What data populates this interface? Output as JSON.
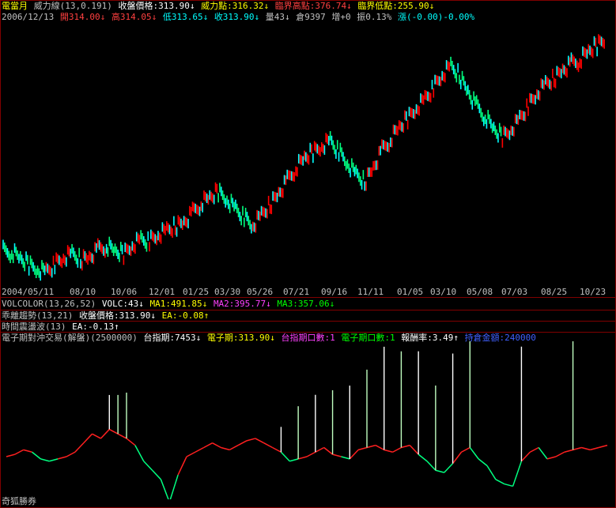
{
  "header": {
    "line1": [
      {
        "t": "電當月",
        "c": "c-yel"
      },
      {
        "t": "威力線(13,0.191)",
        "c": "c-gray"
      },
      {
        "t": "收盤價格:313.90↓",
        "c": "c-white"
      },
      {
        "t": "威力點:316.32↓",
        "c": "c-yel"
      },
      {
        "t": "臨界高點:376.74↓",
        "c": "c-red"
      },
      {
        "t": "臨界低點:255.90↓",
        "c": "c-yel"
      }
    ],
    "line2": [
      {
        "t": "2006/12/13",
        "c": "c-gray"
      },
      {
        "t": "開314.00↓",
        "c": "c-red"
      },
      {
        "t": "高314.05↓",
        "c": "c-red"
      },
      {
        "t": "低313.65↓",
        "c": "c-cyan"
      },
      {
        "t": "收313.90↓",
        "c": "c-cyan"
      },
      {
        "t": "量43↓",
        "c": "c-gray"
      },
      {
        "t": "倉9397",
        "c": "c-gray"
      },
      {
        "t": "增+0",
        "c": "c-gray"
      },
      {
        "t": "振0.13%",
        "c": "c-gray"
      },
      {
        "t": "漲(-0.00)-0.00%",
        "c": "c-cyan"
      }
    ]
  },
  "indicators": {
    "volcolor": [
      {
        "t": "VOLCOLOR(13,26,52)",
        "c": "c-gray"
      },
      {
        "t": "VOLC:43↓",
        "c": "c-white"
      },
      {
        "t": "MA1:491.85↓",
        "c": "c-yel"
      },
      {
        "t": "MA2:395.77↓",
        "c": "c-mag"
      },
      {
        "t": "MA3:357.06↓",
        "c": "c-grn"
      }
    ],
    "deviation": [
      {
        "t": "乖離趨勢(13,21)",
        "c": "c-gray"
      },
      {
        "t": "收盤價格:313.90↓",
        "c": "c-white"
      },
      {
        "t": "EA:-0.08↑",
        "c": "c-yel"
      }
    ],
    "oscillation": [
      {
        "t": "時間震盪波(13)",
        "c": "c-gray"
      },
      {
        "t": "EA:-0.13↑",
        "c": "c-white"
      }
    ],
    "hedge": [
      {
        "t": "電子期對沖交易(解盤)(2500000)",
        "c": "c-gray"
      },
      {
        "t": "台指期:7453↓",
        "c": "c-white"
      },
      {
        "t": "電子期:313.90↓",
        "c": "c-yel"
      },
      {
        "t": "台指期口數:1",
        "c": "c-mag"
      },
      {
        "t": "電子期口數:1",
        "c": "c-grn"
      },
      {
        "t": "報酬率:3.49↑",
        "c": "c-white"
      },
      {
        "t": "持倉金額:240000",
        "c": "c-blue"
      }
    ]
  },
  "colors": {
    "up": "#ff2020",
    "down": "#00ff80",
    "bullish_bar": "#ff0000",
    "bearish_bar": "#00ffff",
    "border": "#800000",
    "spike": "#ffffff"
  },
  "chart_data": [
    {
      "type": "line",
      "x_tick_labels": [
        "2004/05/11",
        "08/10",
        "10/06",
        "12/01",
        "01/25",
        "03/30",
        "05/26",
        "07/21",
        "09/16",
        "11/11",
        "01/05",
        "03/10",
        "05/08",
        "07/03",
        "08/25",
        "10/23"
      ],
      "series": [
        {
          "values": [
            310,
            308,
            300,
            292,
            286,
            284,
            292,
            300,
            306,
            298,
            302,
            312,
            316,
            310,
            306,
            318,
            326,
            322,
            330,
            336,
            342,
            348,
            360,
            372,
            380,
            388,
            378,
            366,
            354,
            342,
            356,
            370,
            386,
            402,
            418,
            432,
            440,
            448,
            456,
            440,
            424,
            410,
            400,
            420,
            442,
            456,
            472,
            484,
            498,
            510,
            524,
            540,
            552,
            540,
            520,
            500,
            486,
            470,
            460,
            470,
            484,
            500,
            516,
            528,
            536,
            548,
            556,
            560,
            572,
            580,
            590
          ]
        }
      ]
    },
    {
      "type": "line",
      "series": [
        {
          "values": [
            0,
            1,
            3,
            2,
            -1,
            -2,
            -1,
            0,
            2,
            6,
            10,
            8,
            12,
            10,
            8,
            5,
            -2,
            -6,
            -10,
            -20,
            -8,
            0,
            2,
            4,
            6,
            4,
            3,
            5,
            7,
            8,
            6,
            4,
            2,
            -2,
            -1,
            0,
            2,
            4,
            1,
            0,
            -1,
            3,
            4,
            5,
            3,
            2,
            4,
            5,
            1,
            -2,
            -6,
            -7,
            -3,
            2,
            4,
            -1,
            -4,
            -10,
            -12,
            -13,
            -2,
            2,
            4,
            -1,
            0,
            2,
            3,
            4,
            3,
            4,
            5
          ]
        },
        {
          "name": "spikes",
          "values": [
            0,
            0,
            0,
            0,
            0,
            0,
            0,
            0,
            0,
            0,
            0,
            0,
            30,
            34,
            40,
            0,
            0,
            0,
            0,
            0,
            0,
            0,
            0,
            0,
            0,
            0,
            0,
            0,
            0,
            0,
            0,
            0,
            22,
            0,
            46,
            0,
            50,
            0,
            56,
            0,
            64,
            0,
            68,
            0,
            90,
            0,
            84,
            0,
            90,
            0,
            74,
            0,
            96,
            0,
            100,
            0,
            0,
            0,
            0,
            0,
            100,
            0,
            0,
            0,
            0,
            0,
            96,
            0,
            0,
            0,
            0
          ]
        }
      ]
    }
  ],
  "watermark": "奇狐勝券"
}
